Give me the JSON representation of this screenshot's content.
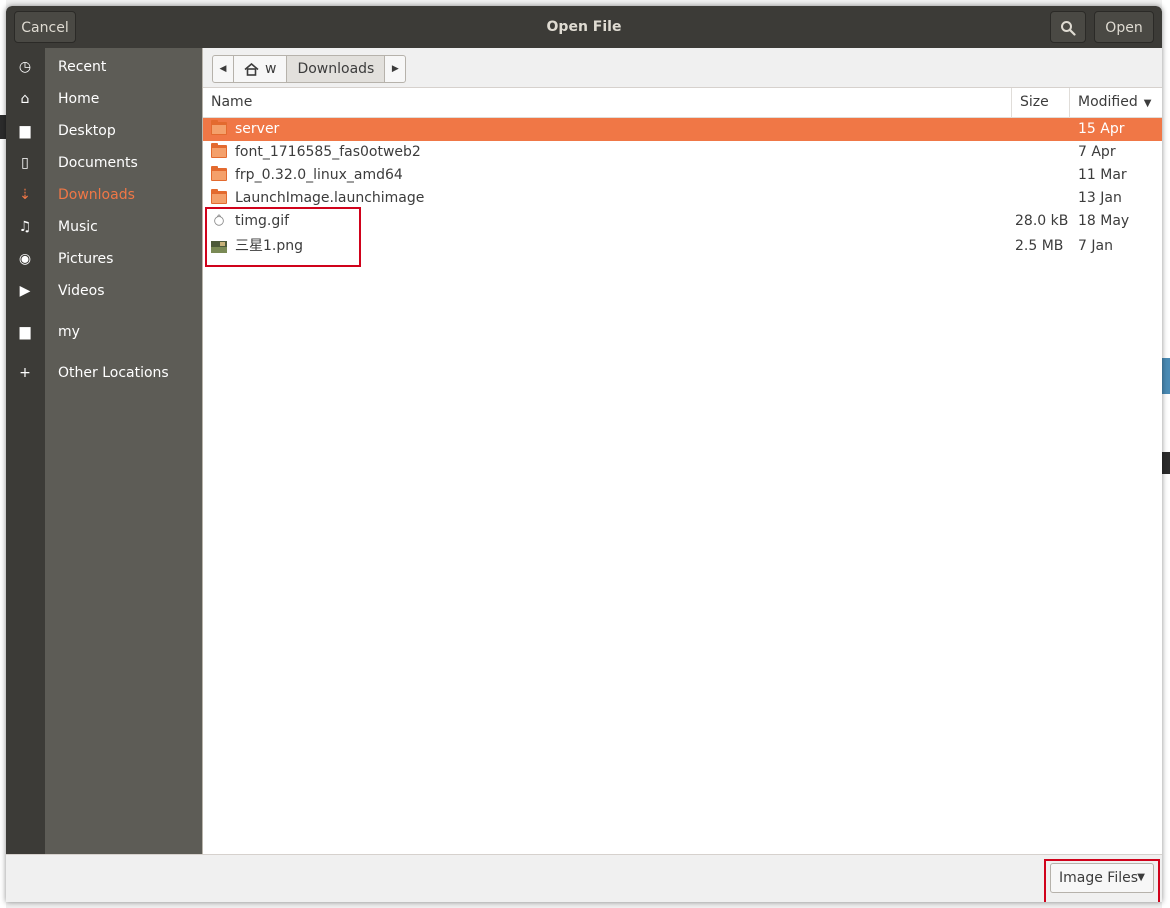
{
  "dialog": {
    "title": "Open File",
    "cancel_label": "Cancel",
    "open_label": "Open",
    "search_icon": "search-icon"
  },
  "sidebar": {
    "items": [
      {
        "label": "Recent",
        "icon": "clock-icon",
        "glyph": "◷"
      },
      {
        "label": "Home",
        "icon": "home-icon",
        "glyph": "⌂"
      },
      {
        "label": "Desktop",
        "icon": "folder-icon",
        "glyph": "▆"
      },
      {
        "label": "Documents",
        "icon": "document-icon",
        "glyph": "▯"
      },
      {
        "label": "Downloads",
        "icon": "download-icon",
        "glyph": "⇣"
      },
      {
        "label": "Music",
        "icon": "music-icon",
        "glyph": "♫"
      },
      {
        "label": "Pictures",
        "icon": "camera-icon",
        "glyph": "◉"
      },
      {
        "label": "Videos",
        "icon": "video-icon",
        "glyph": "▶"
      },
      {
        "label": "my",
        "icon": "folder-icon",
        "glyph": "▆"
      },
      {
        "label": "Other Locations",
        "icon": "plus-icon",
        "glyph": "+"
      }
    ],
    "active": "Downloads"
  },
  "pathbar": {
    "home_label": "w",
    "current_label": "Downloads"
  },
  "columns": {
    "name": "Name",
    "size": "Size",
    "modified": "Modified"
  },
  "files": [
    {
      "name": "server",
      "size": "",
      "modified": "15 Apr",
      "type": "folder",
      "selected": true
    },
    {
      "name": "font_1716585_fas0otweb2",
      "size": "",
      "modified": "7 Apr",
      "type": "folder"
    },
    {
      "name": "frp_0.32.0_linux_amd64",
      "size": "",
      "modified": "11 Mar",
      "type": "folder"
    },
    {
      "name": "LaunchImage.launchimage",
      "size": "",
      "modified": "13 Jan",
      "type": "folder"
    },
    {
      "name": "timg.gif",
      "size": "28.0 kB",
      "modified": "18 May",
      "type": "gif"
    },
    {
      "name": "三星1.png",
      "size": "2.5 MB",
      "modified": "7 Jan",
      "type": "image"
    }
  ],
  "filter": {
    "selected": "Image Files"
  },
  "colors": {
    "accent": "#f07746",
    "headerbar": "#3c3b37",
    "sidebar": "#5d5c56",
    "highlight_box": "#d0021b"
  }
}
